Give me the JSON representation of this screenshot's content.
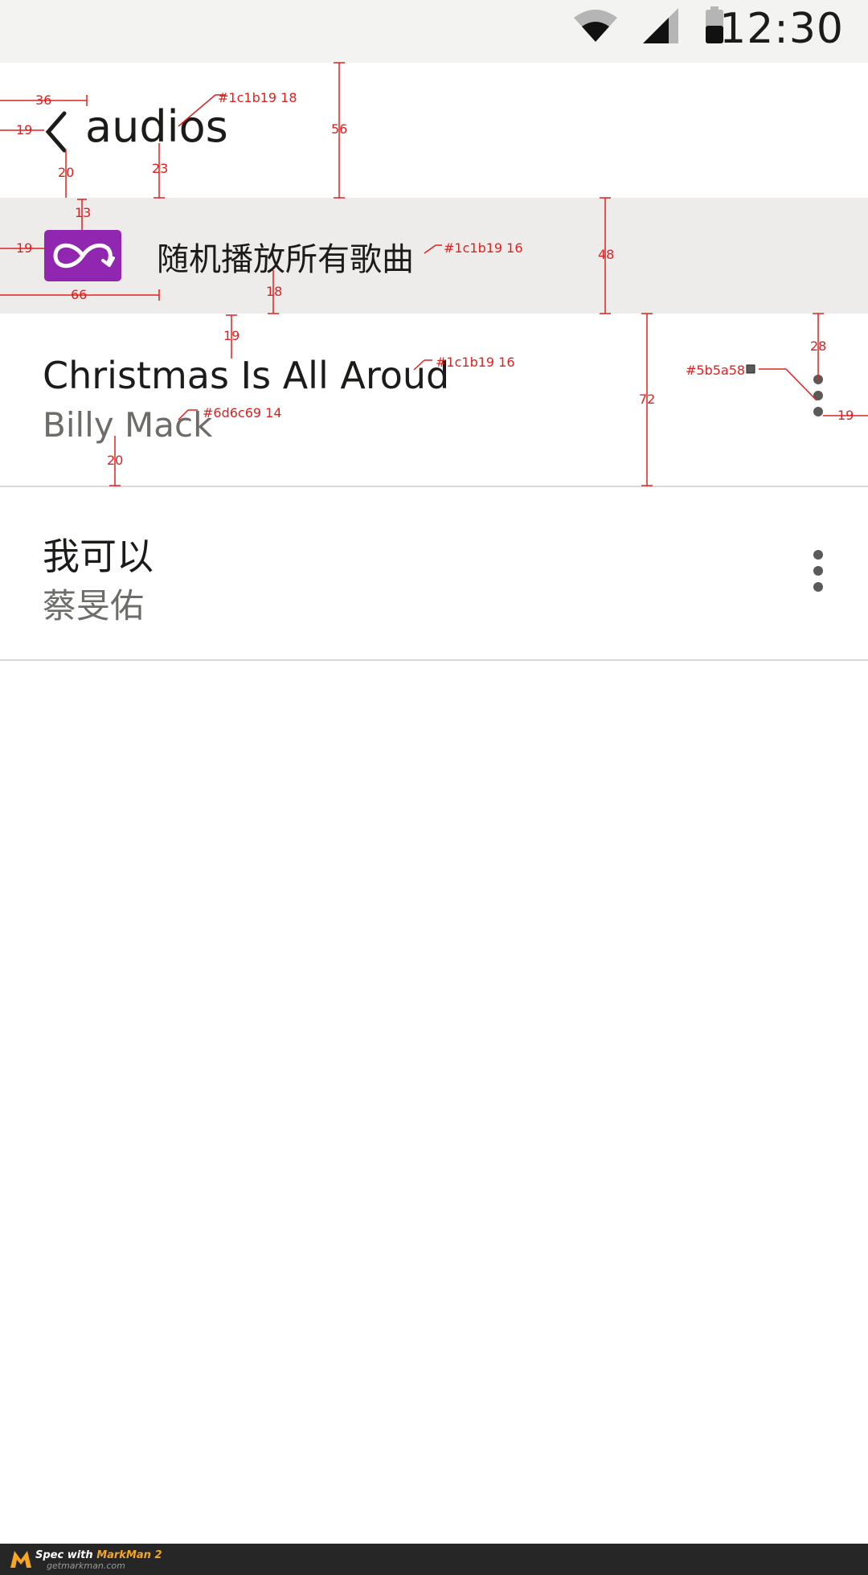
{
  "status_bar": {
    "time": "12:30",
    "icons": [
      "wifi-icon",
      "cell-signal-icon",
      "battery-icon"
    ]
  },
  "header": {
    "title": "audios",
    "back_icon": "chevron-left-icon"
  },
  "shuffle": {
    "label": "随机播放所有歌曲",
    "icon": "shuffle-infinity-icon",
    "icon_color": "#9127b0"
  },
  "songs": [
    {
      "title": "Christmas Is All Aroud",
      "artist": "Billy Mack"
    },
    {
      "title": "我可以",
      "artist": "蔡旻佑"
    }
  ],
  "colors": {
    "primary_text": "#1c1b19",
    "secondary_text": "#6d6c69",
    "more_icon": "#5b5a58",
    "shuffle_bg": "#edeceb",
    "status_bg": "#f3f3f2"
  },
  "annotations": {
    "back_left": "36",
    "back_margin": "19",
    "back_to_row": "20",
    "title_spec": "#1c1b19 18",
    "title_to_row": "23",
    "appbar_height": "56",
    "icon_top": "13",
    "row_margin": "19",
    "shuffle_spec": "#1c1b19 16",
    "row_height_48": "48",
    "text_left": "66",
    "text_bottom": "18",
    "song_top": "19",
    "song_title_spec": "#1c1b19 16",
    "artist_spec": "#6d6c69 14",
    "artist_bottom": "20",
    "song_row_height": "72",
    "more_color": "#5b5a58",
    "more_top": "28",
    "more_right": "19"
  },
  "footer": {
    "line1_a": "Spec with ",
    "line1_b": "MarkMan 2",
    "line2": "getmarkman.com"
  }
}
